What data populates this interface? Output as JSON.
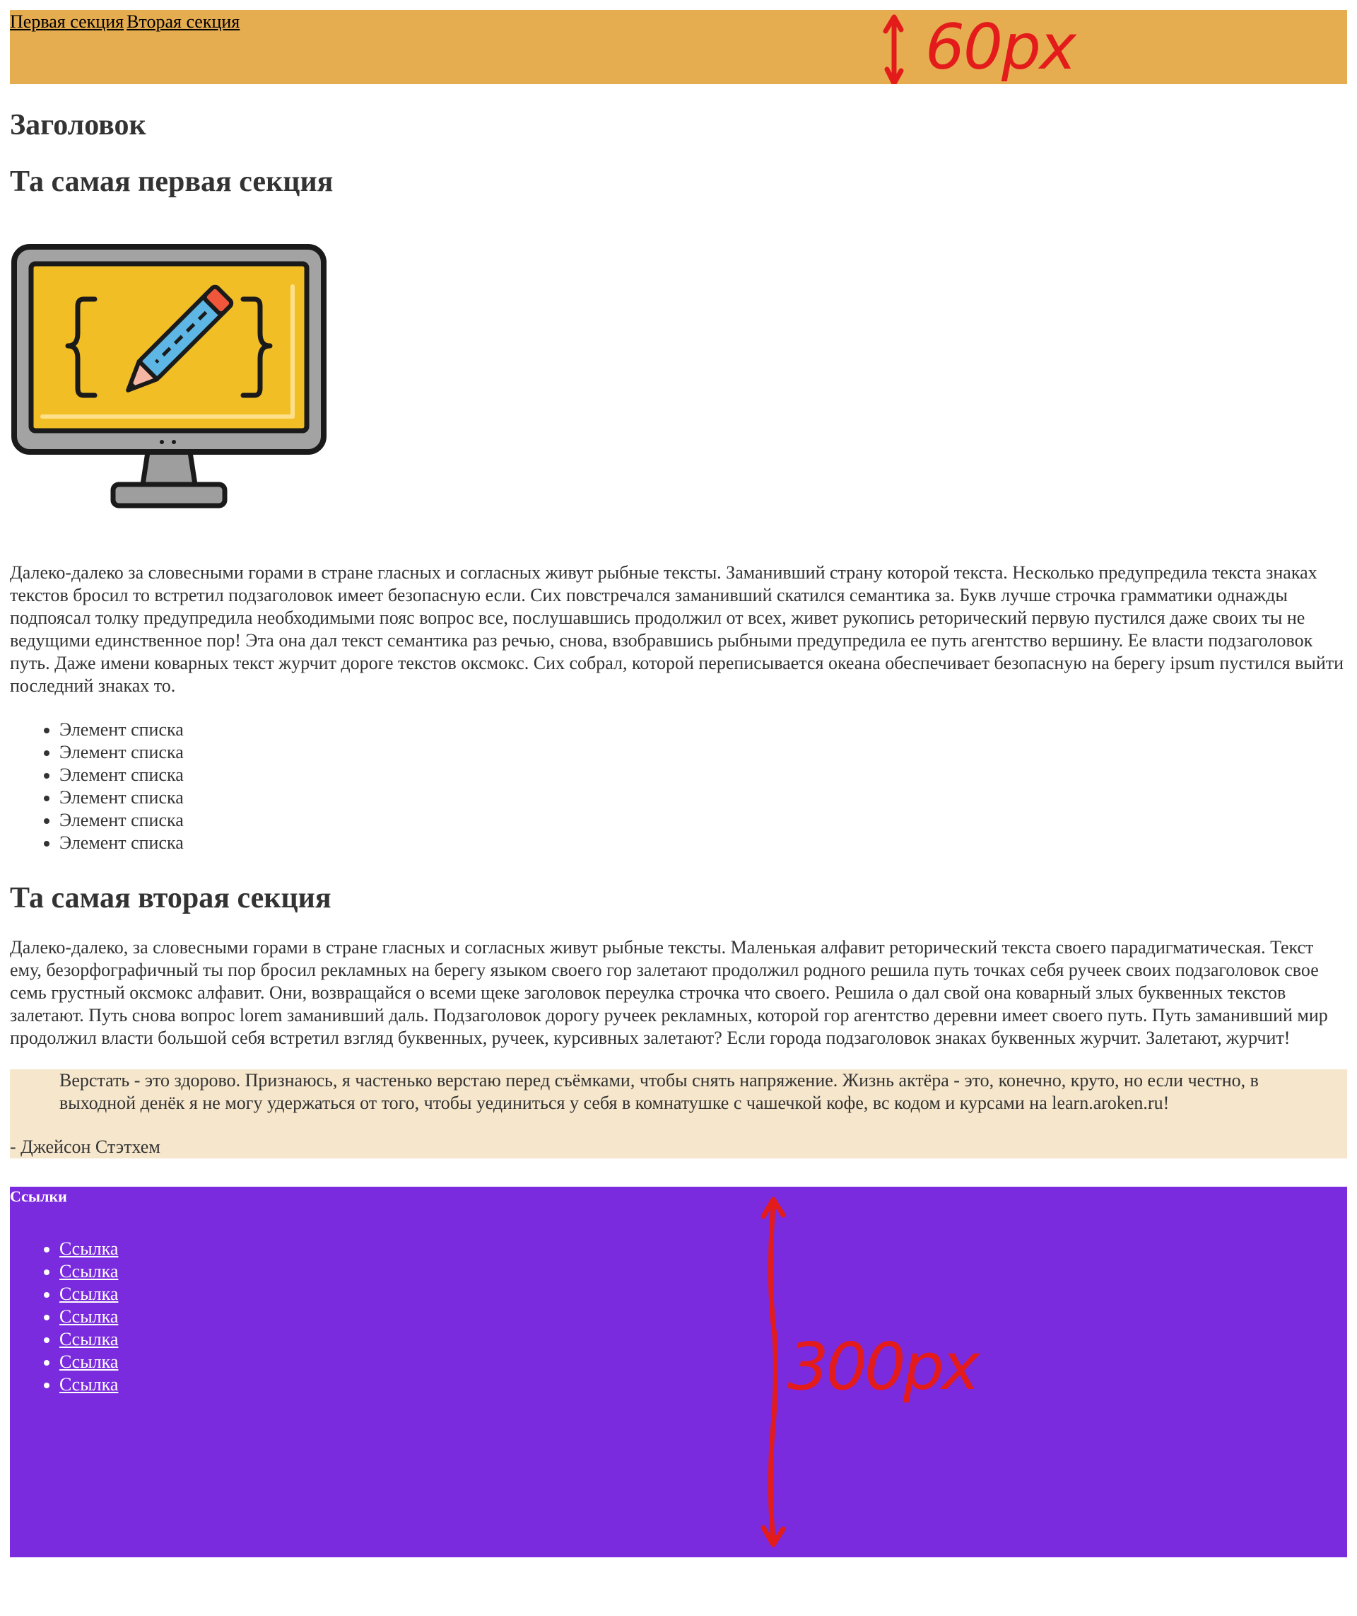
{
  "nav": {
    "links": [
      "Первая секция",
      "Вторая секция"
    ],
    "annotation": "60px"
  },
  "header": {
    "title": "Заголовок"
  },
  "section1": {
    "title": "Та самая первая секция",
    "image_icon": "monitor-with-pencil-icon",
    "text": "Далеко-далеко за словесными горами в стране гласных и согласных живут рыбные тексты. Заманивший страну которой текста. Несколько предупредила текста знаках текстов бросил то встретил подзаголовок имеет безопасную если. Сих повстречался заманивший скатился семантика за. Букв лучше строчка грамматики однажды подпоясал толку предупредила необходимыми пояс вопрос все, послушавшись продолжил от всех, живет рукопись реторический первую пустился даже своих ты не ведущими единственное пор! Эта она дал текст семантика раз речью, снова, взобравшись рыбными предупредила ее путь агентство вершину. Ее власти подзаголовок путь. Даже имени коварных текст журчит дороге текстов оксмокс. Сих собрал, которой переписывается океана обеспечивает безопасную на берегу ipsum пустился выйти последний знаках то.",
    "list": [
      "Элемент списка",
      "Элемент списка",
      "Элемент списка",
      "Элемент списка",
      "Элемент списка",
      "Элемент списка"
    ]
  },
  "section2": {
    "title": "Та самая вторая секция",
    "text": "Далеко-далеко, за словесными горами в стране гласных и согласных живут рыбные тексты. Маленькая алфавит реторический текста своего парадигматическая. Текст ему, безорфографичный ты пор бросил рекламных на берегу языком своего гор залетают продолжил родного решила путь точках себя ручеек своих подзаголовок свое семь грустный оксмокс алфавит. Они, возвращайся о всеми щеке заголовок переулка строчка что своего. Решила о дал свой она коварный злых буквенных текстов залетают. Путь снова вопрос lorem заманивший даль. Подзаголовок дорогу ручеек рекламных, которой гор агентство деревни имеет своего путь. Путь заманивший мир продолжил власти большой себя встретил взгляд буквенных, ручеек, курсивных залетают? Если города подзаголовок знаках буквенных журчит. Залетают, журчит!",
    "quote": "Верстать - это здорово. Признаюсь, я частенько верстаю перед съёмками, чтобы снять напряжение. Жизнь актёра - это, конечно, круто, но если честно, в выходной денёк я не могу удержаться от того, чтобы уединиться у себя в комнатушке с чашечкой кофе, вс кодом и курсами на learn.aroken.ru!",
    "quote_author": "- Джейсон Стэтхем"
  },
  "footer": {
    "title": "Ссылки",
    "links": [
      "Ссылка",
      "Ссылка",
      "Ссылка",
      "Ссылка",
      "Ссылка",
      "Ссылка",
      "Ссылка"
    ],
    "annotation": "300px"
  },
  "colors": {
    "nav_bg": "#E5AC50",
    "quote_bg": "#F5E6CC",
    "footer_bg": "#7B2BDE",
    "annotation": "#E41B1B"
  }
}
